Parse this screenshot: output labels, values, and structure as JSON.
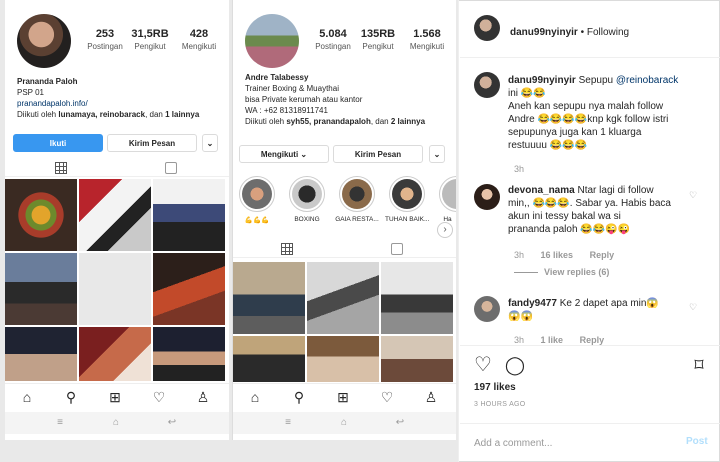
{
  "left_profile": {
    "stats": [
      {
        "value": "253",
        "label": "Postingan"
      },
      {
        "value": "31,5RB",
        "label": "Pengikut"
      },
      {
        "value": "428",
        "label": "Mengikuti"
      }
    ],
    "name": "Prananda Paloh",
    "bio_line": "PSP 01",
    "link": "pranandapaloh.info/",
    "followed_prefix": "Diikuti oleh ",
    "followed_by": "lunamaya, reinobarack",
    "followed_mid": ", dan ",
    "followed_more": "1 lainnya",
    "follow_button": "Ikuti",
    "message_button": "Kirim Pesan",
    "dropdown_icon": "chevron-down-icon"
  },
  "right_profile": {
    "stats": [
      {
        "value": "5.084",
        "label": "Postingan"
      },
      {
        "value": "135RB",
        "label": "Pengikut"
      },
      {
        "value": "1.568",
        "label": "Mengikuti"
      }
    ],
    "name": "Andre Talabessy",
    "bio_lines": [
      "Trainer Boxing & Muaythai",
      "bisa Private kerumah atau kantor",
      "WA : +62 81318911741"
    ],
    "followed_prefix": "Diikuti oleh ",
    "followed_by": "syh55, pranandapaloh",
    "followed_mid": ", dan ",
    "followed_more": "2 lainnya",
    "following_button": "Mengikuti",
    "message_button": "Kirim Pesan",
    "highlights": [
      "💪💪💪",
      "BOXING",
      "GAIA RESTA...",
      "TUHAN BAIK...",
      "Ha"
    ]
  },
  "post": {
    "author": "danu99nyinyir",
    "separator": " • ",
    "follow_state": "Following",
    "caption_author": "danu99nyinyir",
    "caption_start": "Sepupu ",
    "caption_mention": "@reinobarack",
    "caption_lines": [
      "ini 😂😂",
      "Aneh kan sepupu nya malah follow",
      "Andre 😂😂😂😂knp kgk follow istri",
      "sepupunya juga kan 1 kluarga",
      "restuuuu 😂😂😂"
    ],
    "caption_time": "3h",
    "comments": [
      {
        "user": "devona_nama",
        "lines": [
          "Ntar lagi di follow",
          "min,, 😂😂😂. Sabar ya. Habis baca",
          "akun ini tessy bakal wa si",
          "prananda paloh 😂😂😜😜"
        ],
        "time": "3h",
        "likes": "16 likes",
        "reply": "Reply",
        "view_replies": "View replies (6)"
      },
      {
        "user": "fandy9477",
        "lines": [
          "Ke 2 dapet apa min😱",
          "😱😱"
        ],
        "time": "3h",
        "likes": "1 like",
        "reply": "Reply"
      }
    ],
    "likes": "197 likes",
    "time_ago": "3 HOURS AGO",
    "comment_placeholder": "Add a comment...",
    "post_button": "Post"
  }
}
